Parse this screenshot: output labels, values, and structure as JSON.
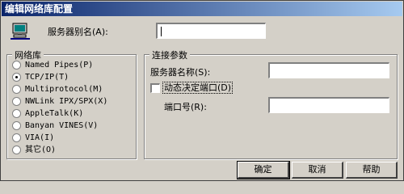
{
  "window": {
    "title": "编辑网络库配置"
  },
  "alias": {
    "label": "服务器别名(A):",
    "value": ""
  },
  "network_library": {
    "title": "网络库",
    "options": [
      {
        "label": "Named Pipes(P)",
        "checked": false
      },
      {
        "label": "TCP/IP(T)",
        "checked": true
      },
      {
        "label": "Multiprotocol(M)",
        "checked": false
      },
      {
        "label": "NWLink IPX/SPX(X)",
        "checked": false
      },
      {
        "label": "AppleTalk(K)",
        "checked": false
      },
      {
        "label": "Banyan VINES(V)",
        "checked": false
      },
      {
        "label": "VIA(I)",
        "checked": false
      },
      {
        "label": "其它(O)",
        "checked": false
      }
    ]
  },
  "connection": {
    "title": "连接参数",
    "server_name_label": "服务器名称(S):",
    "server_name_value": "",
    "dynamic_port_label": "动态决定端口(D)",
    "dynamic_port_checked": false,
    "port_label": "端口号(R):",
    "port_value": ""
  },
  "buttons": {
    "ok": "确定",
    "cancel": "取消",
    "help": "帮助"
  },
  "icons": {
    "app": "computer-network-icon"
  }
}
